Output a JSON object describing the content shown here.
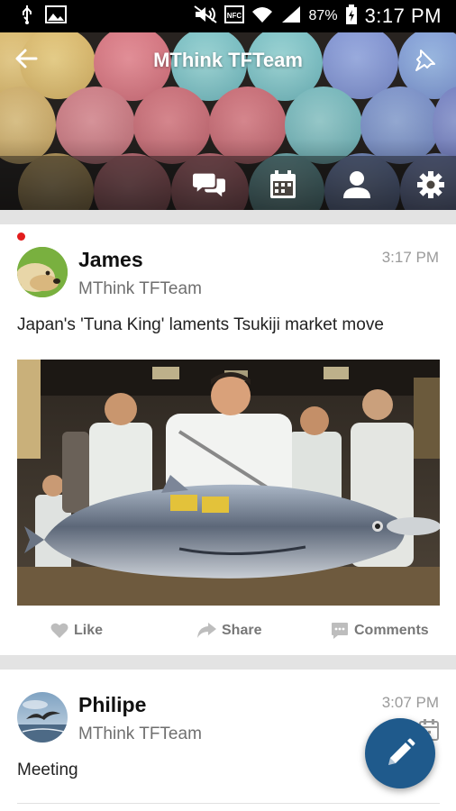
{
  "status_bar": {
    "time": "3:17 PM",
    "battery": "87%",
    "icons": [
      "usb-icon",
      "image-icon",
      "mute-icon",
      "nfc-icon",
      "wifi-icon",
      "signal-icon",
      "battery-icon"
    ]
  },
  "header": {
    "title": "MThink TFTeam",
    "tabs": [
      "chat-icon",
      "calendar-icon",
      "person-icon",
      "gear-icon"
    ]
  },
  "posts": [
    {
      "author": "James",
      "team": "MThink TFTeam",
      "time": "3:17 PM",
      "text": "Japan's 'Tuna King' laments Tsukiji market move",
      "unread": true
    },
    {
      "author": "Philipe",
      "team": "MThink TFTeam",
      "time": "3:07 PM",
      "text": "Meeting"
    }
  ],
  "actions": {
    "like": "Like",
    "share": "Share",
    "comments": "Comments"
  },
  "colors": {
    "fab": "#1f5a8c",
    "unread_dot": "#e21c1c",
    "separator": "#e3e3e3"
  }
}
